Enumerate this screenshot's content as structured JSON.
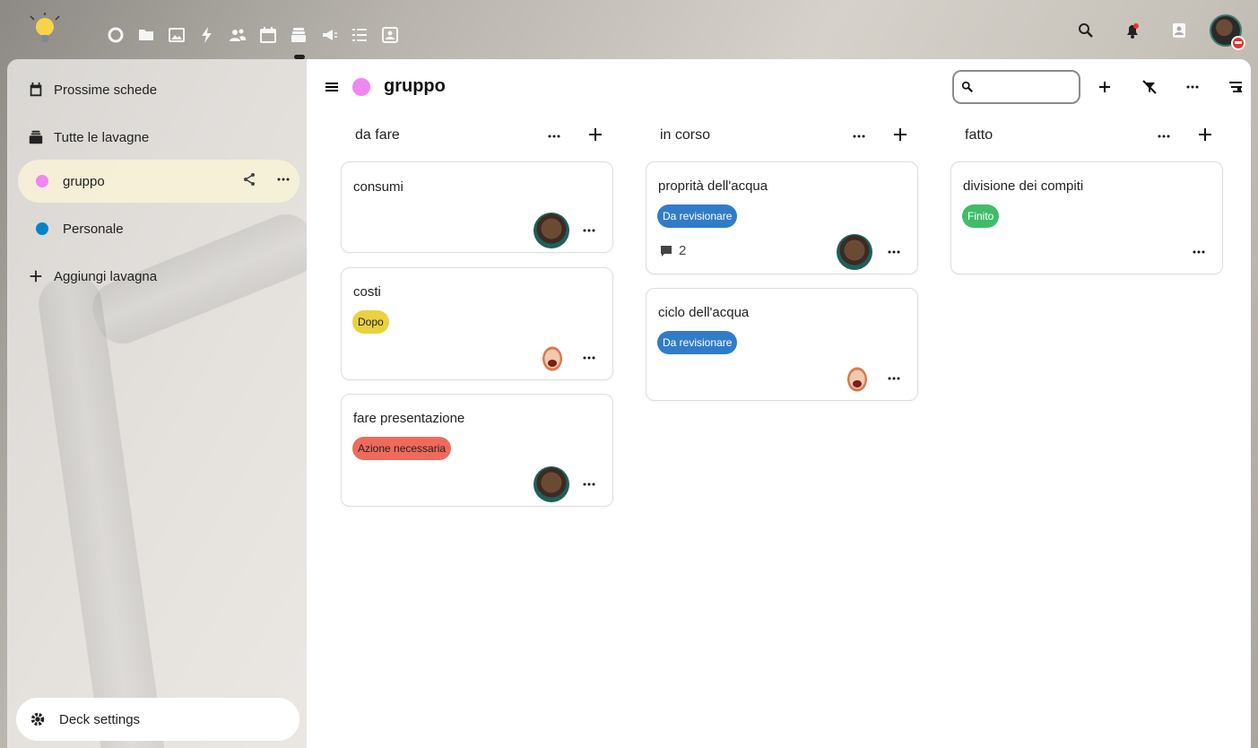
{
  "topbar": {
    "apps": [
      "dashboard-icon",
      "files-icon",
      "photos-icon",
      "activity-icon",
      "contacts-icon",
      "calendar-icon",
      "deck-icon",
      "announcements-icon",
      "tasks-icon",
      "forms-icon"
    ],
    "active_app": "deck-icon"
  },
  "sidebar": {
    "upcoming": "Prossime schede",
    "all_boards": "Tutte le lavagne",
    "boards": [
      {
        "label": "gruppo",
        "color": "#ef86f2"
      },
      {
        "label": "Personale",
        "color": "#0082c9"
      }
    ],
    "add_board": "Aggiungi lavagna",
    "settings": "Deck settings"
  },
  "board": {
    "title": "gruppo",
    "color": "#ef86f2",
    "search_placeholder": ""
  },
  "stacks": [
    {
      "title": "da fare",
      "cards": [
        {
          "title": "consumi"
        },
        {
          "title": "costi",
          "label": "Dopo"
        },
        {
          "title": "fare presentazione",
          "label": "Azione necessaria"
        }
      ]
    },
    {
      "title": "in corso",
      "cards": [
        {
          "title": "proprità dell'acqua",
          "label": "Da revisionare",
          "comments": "2"
        },
        {
          "title": "ciclo dell'acqua",
          "label": "Da revisionare"
        }
      ]
    },
    {
      "title": "fatto",
      "cards": [
        {
          "title": "divisione dei compiti",
          "label": "Finito"
        }
      ]
    }
  ],
  "label_colors": {
    "Dopo": "#e9d13f",
    "Azione necessaria": "#f06a5c",
    "Da revisionare": "#317cc9",
    "Finito": "#3fbd6a"
  }
}
